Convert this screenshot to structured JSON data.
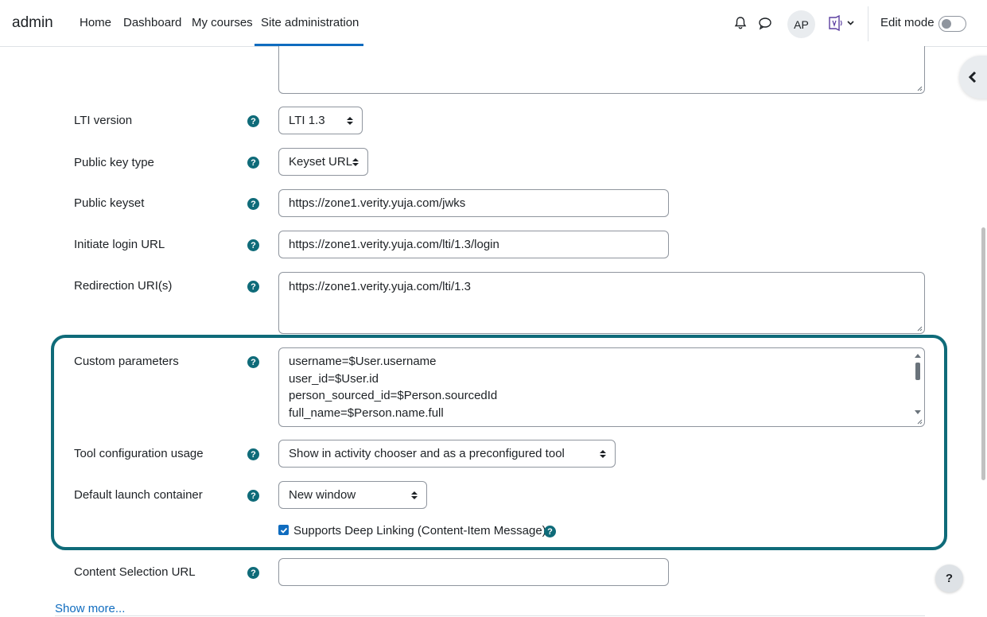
{
  "navbar": {
    "brand": "admin",
    "links": [
      "Home",
      "Dashboard",
      "My courses",
      "Site administration"
    ],
    "active_link": "Site administration",
    "user_initials": "AP",
    "edit_mode_label": "Edit mode",
    "edit_mode_on": false
  },
  "form": {
    "lti_version": {
      "label": "LTI version",
      "value": "LTI 1.3"
    },
    "public_key_type": {
      "label": "Public key type",
      "value": "Keyset URL"
    },
    "public_keyset": {
      "label": "Public keyset",
      "value": "https://zone1.verity.yuja.com/jwks"
    },
    "initiate_login_url": {
      "label": "Initiate login URL",
      "value": "https://zone1.verity.yuja.com/lti/1.3/login"
    },
    "redirection_uris": {
      "label": "Redirection URI(s)",
      "value": "https://zone1.verity.yuja.com/lti/1.3"
    },
    "custom_parameters": {
      "label": "Custom parameters",
      "lines": [
        "username=$User.username",
        "user_id=$User.id",
        "person_sourced_id=$Person.sourcedId",
        "full_name=$Person.name.full"
      ]
    },
    "tool_config_usage": {
      "label": "Tool configuration usage",
      "value": "Show in activity chooser and as a preconfigured tool"
    },
    "default_launch_container": {
      "label": "Default launch container",
      "value": "New window"
    },
    "deep_linking": {
      "label": "Supports Deep Linking (Content-Item Message)",
      "checked": true
    },
    "content_selection_url": {
      "label": "Content Selection URL",
      "value": ""
    }
  },
  "show_more": "Show more...",
  "help_fab": "?",
  "colors": {
    "accent": "#0f6cbf",
    "highlight": "#0f6b79",
    "help_icon": "#0f6b79"
  }
}
